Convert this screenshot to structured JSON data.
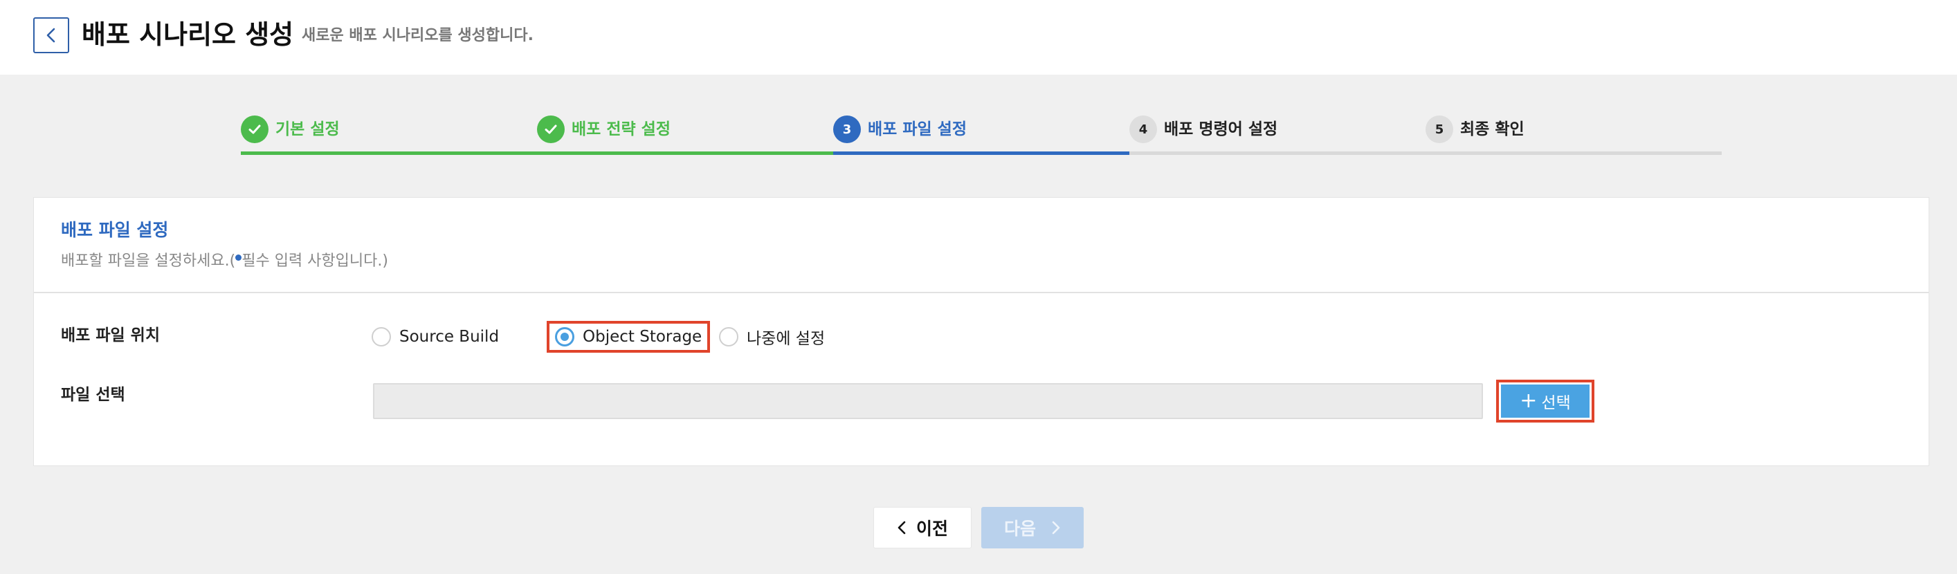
{
  "header": {
    "title": "배포 시나리오 생성",
    "subtitle": "새로운 배포 시나리오를 생성합니다."
  },
  "stepper": {
    "steps": [
      {
        "number": "1",
        "label": "기본 설정",
        "state": "done"
      },
      {
        "number": "2",
        "label": "배포 전략 설정",
        "state": "done"
      },
      {
        "number": "3",
        "label": "배포 파일 설정",
        "state": "active"
      },
      {
        "number": "4",
        "label": "배포 명령어 설정",
        "state": "todo"
      },
      {
        "number": "5",
        "label": "최종 확인",
        "state": "todo"
      }
    ]
  },
  "panel": {
    "title": "배포 파일 설정",
    "desc_prefix": "배포할 파일을 설정하세요.(",
    "desc_suffix": "필수 입력 사항입니다.)",
    "location_label": "배포 파일 위치",
    "radio_options": [
      {
        "label": "Source Build",
        "selected": false
      },
      {
        "label": "Object Storage",
        "selected": true
      },
      {
        "label": "나중에 설정",
        "selected": false
      }
    ],
    "file_label": "파일 선택",
    "file_value": "",
    "select_button": "선택"
  },
  "footer": {
    "prev_label": "이전",
    "next_label": "다음"
  },
  "colors": {
    "done": "#4cbb4c",
    "active": "#2f6ac0",
    "highlight": "#e0442b",
    "select_button": "#4aa3e2",
    "next_disabled": "#b9d1ec"
  }
}
